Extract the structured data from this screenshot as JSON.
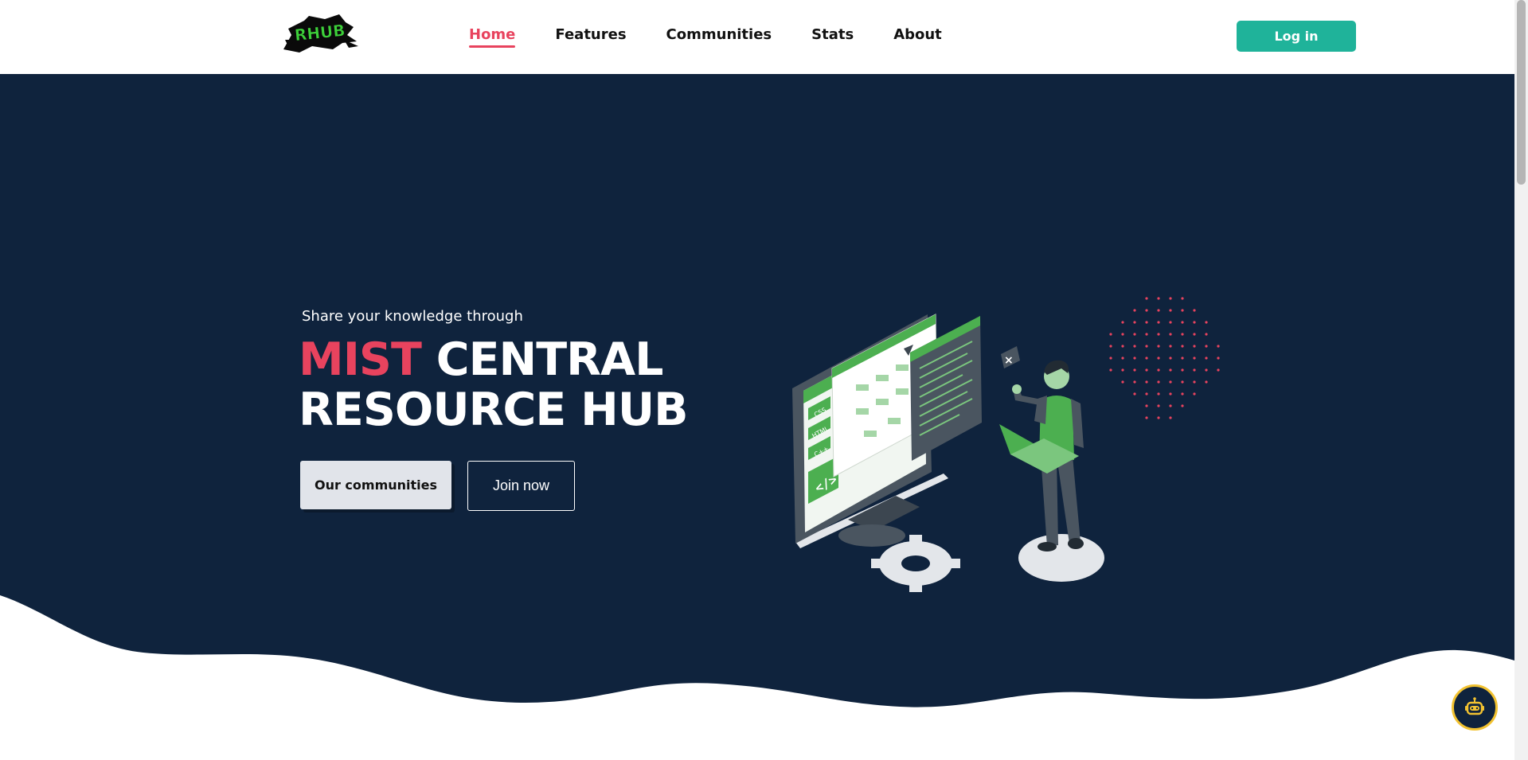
{
  "header": {
    "logo_text": "RHUB",
    "nav": [
      {
        "label": "Home",
        "active": true
      },
      {
        "label": "Features",
        "active": false
      },
      {
        "label": "Communities",
        "active": false
      },
      {
        "label": "Stats",
        "active": false
      },
      {
        "label": "About",
        "active": false
      }
    ],
    "login_label": "Log in"
  },
  "hero": {
    "subtitle": "Share your knowledge through",
    "title_accent": "MIST",
    "title_line1_rest": "CENTRAL",
    "title_line2": "RESOURCE HUB",
    "primary_button": "Our communities",
    "secondary_button": "Join now",
    "illustration": {
      "screen_tags": [
        "CSS",
        "HTML",
        "C++"
      ],
      "code_symbol": "</>"
    }
  },
  "colors": {
    "brand_dark": "#0f233d",
    "accent_pink": "#e8435e",
    "login_green": "#1fb39a",
    "illustration_green": "#4caf50",
    "chat_ring": "#f2c230"
  }
}
